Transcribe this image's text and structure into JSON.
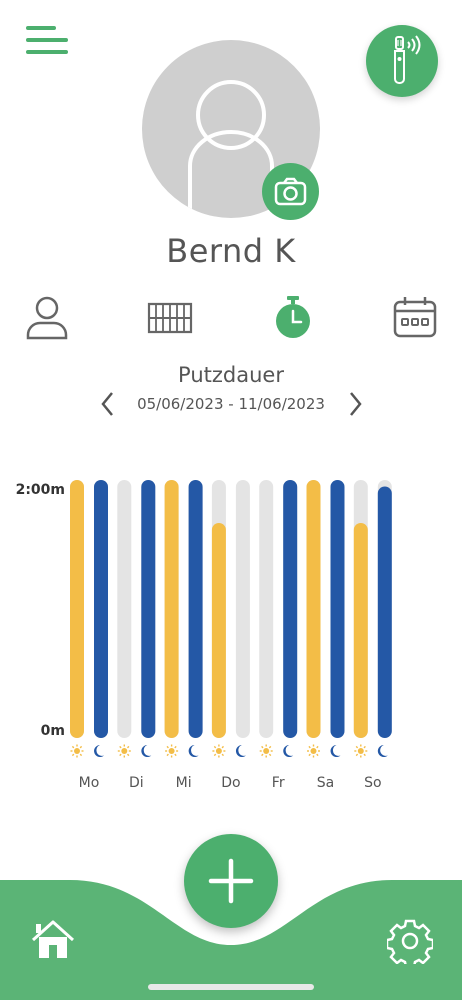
{
  "profile": {
    "name": "Bernd K"
  },
  "tabs": [
    {
      "icon": "person-icon",
      "active": false
    },
    {
      "icon": "teeth-icon",
      "active": false
    },
    {
      "icon": "stopwatch-icon",
      "active": true
    },
    {
      "icon": "calendar-icon",
      "active": false
    }
  ],
  "stats": {
    "title": "Putzdauer",
    "date_range": "05/06/2023 - 11/06/2023"
  },
  "colors": {
    "brand_green": "#4caf6e",
    "morning": "#f3bd47",
    "evening": "#2458a6",
    "empty": "#e4e4e4"
  },
  "chart_data": {
    "type": "bar",
    "y_tick_labels": [
      "2:00m",
      "0m"
    ],
    "ylim": [
      0,
      120
    ],
    "unit": "seconds",
    "categories": [
      "Mo",
      "Di",
      "Mi",
      "Do",
      "Fr",
      "Sa",
      "So"
    ],
    "series": [
      {
        "slot": "morning",
        "icon": "sun-icon",
        "values": [
          120,
          0,
          120,
          100,
          0,
          120,
          100
        ]
      },
      {
        "slot": "evening",
        "icon": "moon-icon",
        "values": [
          120,
          120,
          120,
          0,
          120,
          120,
          117
        ]
      }
    ]
  }
}
